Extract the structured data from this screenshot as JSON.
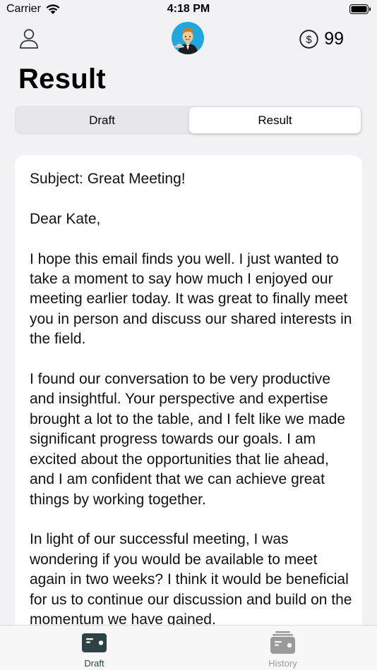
{
  "status_bar": {
    "carrier": "Carrier",
    "time": "4:18 PM"
  },
  "header": {
    "profile_icon": "person-icon",
    "avatar_icon": "waiter-avatar",
    "coin_icon": "dollar-coin-icon",
    "credits": "99"
  },
  "page": {
    "title": "Result"
  },
  "segments": [
    {
      "label": "Draft",
      "selected": false
    },
    {
      "label": "Result",
      "selected": true
    }
  ],
  "email": {
    "text": "Subject: Great Meeting!\n\nDear Kate,\n\nI hope this email finds you well. I just wanted to take a moment to say how much I enjoyed our meeting earlier today. It was great to finally meet you in person and discuss our shared interests in the field.\n\nI found our conversation to be very productive and insightful. Your perspective and expertise brought a lot to the table, and I felt like we made significant progress towards our goals. I am excited about the opportunities that lie ahead, and I am confident that we can achieve great things by working together.\n\nIn light of our successful meeting, I was wondering if you would be available to meet again in two weeks? I think it would be beneficial for us to continue our discussion and build on the momentum we have gained."
  },
  "tab_bar": {
    "tabs": [
      {
        "label": "Draft",
        "icon": "draft-icon",
        "active": true
      },
      {
        "label": "History",
        "icon": "history-icon",
        "active": false
      }
    ]
  },
  "colors": {
    "background": "#f2f2f4",
    "active_tab": "#2e4245",
    "inactive_tab": "#9a9a9a",
    "avatar_bg": "#21a7dd"
  }
}
